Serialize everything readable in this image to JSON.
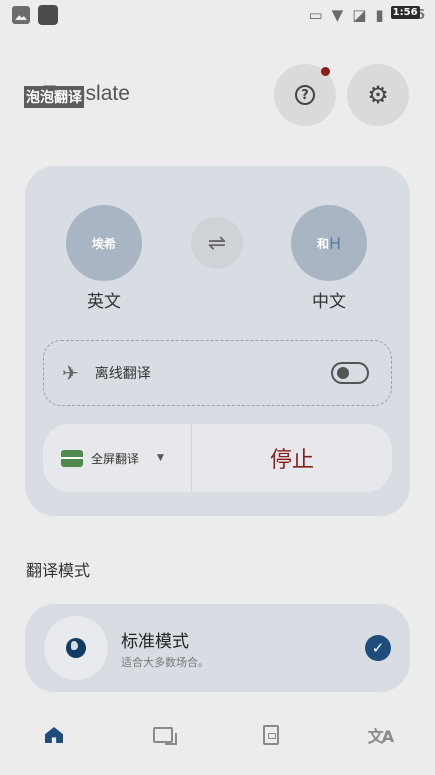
{
  "status_bar": {
    "time": "1:56",
    "time_overlay": "1:56",
    "icons": [
      "image-icon",
      "app-icon",
      "cast-icon",
      "wifi-icon",
      "no-sim-icon",
      "battery-icon"
    ]
  },
  "header": {
    "title": "e Translate",
    "title_overlay": "泡泡翻译",
    "help_label": "?",
    "settings_label": "⚙",
    "notification_color": "#8b1c1c"
  },
  "languages": {
    "source_overlay": "埃希",
    "source_name": "英文",
    "swap_label": "⇌",
    "target_overlay": "和",
    "target_extra": "H",
    "target_name": "中文"
  },
  "offline": {
    "label": "离线翻译",
    "enabled": false
  },
  "controls": {
    "mode_label": "全屏翻译",
    "caret": "▼",
    "stop_label": "停止"
  },
  "section": {
    "title": "翻译模式"
  },
  "modes": [
    {
      "name": "标准模式",
      "description": "适合大多数场合。",
      "selected": true,
      "check": "✓"
    }
  ],
  "nav": {
    "items": [
      "home-icon",
      "chat-icon",
      "document-icon",
      "translate-icon"
    ],
    "translate_glyph": "文A",
    "active": "home"
  },
  "colors": {
    "accent": "#1f4c7a",
    "stop": "#8b1c1c",
    "card": "#d8dde3"
  }
}
